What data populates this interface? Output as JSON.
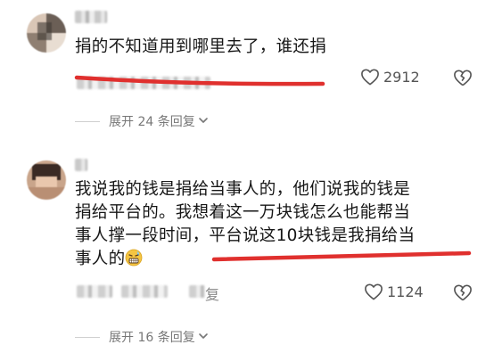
{
  "comments": [
    {
      "text": "捐的不知道用到哪里去了，谁还捐",
      "likes": "2912"
    },
    {
      "lines": [
        "我说我的钱是捐给当事人的，他们说我的钱是",
        "捐给平台的。我想着这一万块钱怎么也能帮当",
        "事人撑一段时间，平台说这10块钱是我捐给当",
        "事人的"
      ],
      "reply_tail": "复",
      "likes": "1124"
    }
  ],
  "expand_replies": [
    {
      "label": "展开 24 条回复"
    },
    {
      "label": "展开 16 条回复"
    }
  ],
  "icons": {
    "heart": "heart-outline-icon",
    "dislike": "broken-heart-icon",
    "chevron": "chevron-down-icon",
    "emoji": "grimacing-sweat-emoji"
  },
  "colors": {
    "annotation": "#e0302e",
    "meta": "#888888"
  }
}
